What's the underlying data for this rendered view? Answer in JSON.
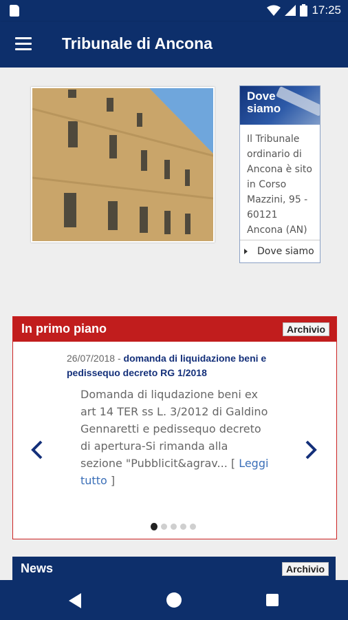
{
  "status_bar": {
    "time": "17:25"
  },
  "app_bar": {
    "title": "Tribunale di Ancona"
  },
  "dove_siamo": {
    "heading": "Dove siamo",
    "body": "Il Tribunale ordinario di Ancona è sito in Corso Mazzini, 95 - 60121 Ancona (AN)",
    "link_label": "Dove siamo"
  },
  "primo_piano": {
    "title": "In primo piano",
    "archive_label": "Archivio",
    "item": {
      "date": "26/07/2018 - ",
      "headline": "domanda di liquidazione beni e pedissequo decreto RG 1/2018",
      "body": "Domanda di liqudazione beni ex art 14 TER ss L. 3/2012 di Galdino Gennaretti e pedissequo decreto di apertura-Si rimanda alla sezione \"Pubblicit&agrav... ",
      "read_more_open": "[ ",
      "read_more": "Leggi tutto",
      "read_more_close": " ]"
    },
    "carousel": {
      "count": 5,
      "active": 1
    }
  },
  "news": {
    "title": "News",
    "archive_label": "Archivio"
  },
  "icons": {
    "menu": "menu-icon",
    "wifi": "wifi-icon",
    "signal": "signal-icon",
    "battery": "battery-icon",
    "sd": "sd-card-icon",
    "prev": "chevron-left-icon",
    "next": "chevron-right-icon",
    "back": "back-icon",
    "home": "home-icon",
    "recent": "recent-apps-icon"
  },
  "colors": {
    "primary": "#0d2f6b",
    "accent_red": "#c11d1d",
    "link": "#3b6fb8"
  }
}
